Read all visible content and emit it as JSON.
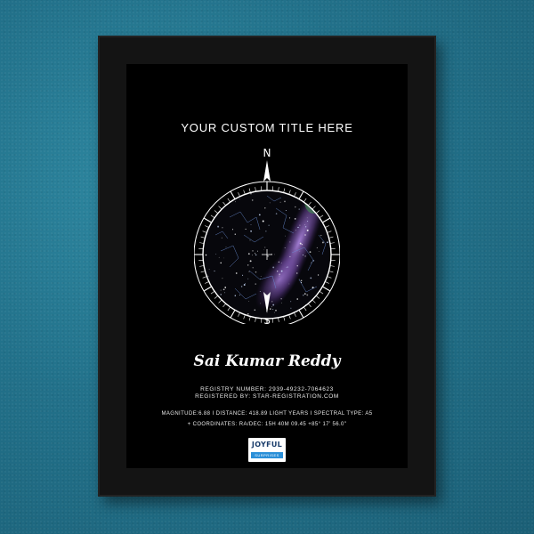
{
  "colors": {
    "wall": "#22718a",
    "frame": "#141414",
    "poster": "#000000",
    "milky_way": "#8a5fc6",
    "text": "#ffffff",
    "logo_accent": "#2a8fd8"
  },
  "poster": {
    "title": "YOUR CUSTOM TITLE HERE",
    "compass_north": "N",
    "compass_south": "S",
    "name": "Sai Kumar Reddy",
    "registry_line": "REGISTRY  NUMBER:  2939-49232-7064623",
    "registered_line": "REGISTERED  BY:  STAR-REGISTRATION.COM",
    "info_line_1": "MAGNITUDE:6.88  I   DISTANCE:   418.89   LIGHT YEARS I   SPECTRAL TYPE: A5",
    "info_line_2": "+ COORDINATES:  RA/DEC:  15H  40M  09.45  +85°  17’  56.0\"",
    "logo_text": "JOYFUL",
    "logo_subtext": "SURPRISES"
  }
}
